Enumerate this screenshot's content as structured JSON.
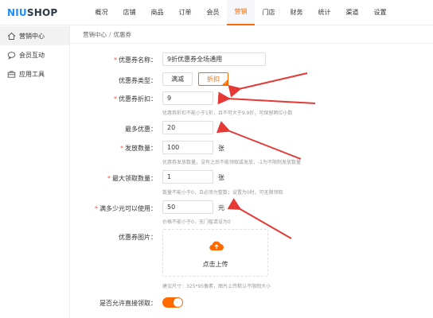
{
  "brand": {
    "logo_part1": "NIU",
    "logo_part2": "SHOP"
  },
  "topnav": {
    "items": [
      "概况",
      "店铺",
      "商品",
      "订单",
      "会员",
      "营销",
      "门店",
      "财务",
      "统计",
      "渠道",
      "设置"
    ],
    "active_index": 5
  },
  "sidebar": {
    "items": [
      {
        "label": "营销中心",
        "icon": "home-icon"
      },
      {
        "label": "会员互动",
        "icon": "chat-icon"
      },
      {
        "label": "应用工具",
        "icon": "toolbox-icon"
      }
    ],
    "active_index": 0
  },
  "breadcrumb": {
    "parent": "营销中心",
    "separator": "/",
    "current": "优惠券"
  },
  "form": {
    "name": {
      "label": "优惠券名称：",
      "value": "9折优惠券全场通用"
    },
    "type": {
      "label": "优惠券类型：",
      "option_full": "满减",
      "option_discount": "折扣",
      "selected": "折扣"
    },
    "discount": {
      "label": "优惠券折扣：",
      "value": "9",
      "unit": "折",
      "hint": "优惠券折扣不能小于1折，且不可大于9.9折，可保留两位小数"
    },
    "max_off": {
      "label": "最多优惠：",
      "value": "20",
      "unit": "元"
    },
    "quantity": {
      "label": "发放数量：",
      "value": "100",
      "unit": "张",
      "hint": "优惠券发放数量，没有之后不能领取或发放，-1为不限制发放数量"
    },
    "max_claim": {
      "label": "最大领取数量：",
      "value": "1",
      "unit": "张",
      "hint": "数量不能小于0，且必须为整数；设置为0时，可无限领取"
    },
    "threshold": {
      "label": "满多少元可以使用：",
      "value": "50",
      "unit": "元",
      "hint": "价格不能小于0，无门槛请设为0"
    },
    "image": {
      "label": "优惠券图片：",
      "upload_text": "点击上传",
      "hint": "建议尺寸：325*95像素，图片上传默认不限制大小"
    },
    "direct_claim": {
      "label": "是否允许直接领取：",
      "enabled": true
    }
  },
  "colors": {
    "accent": "#ff6a00",
    "arrow": "#e53935",
    "brand_blue": "#1a8cff"
  }
}
